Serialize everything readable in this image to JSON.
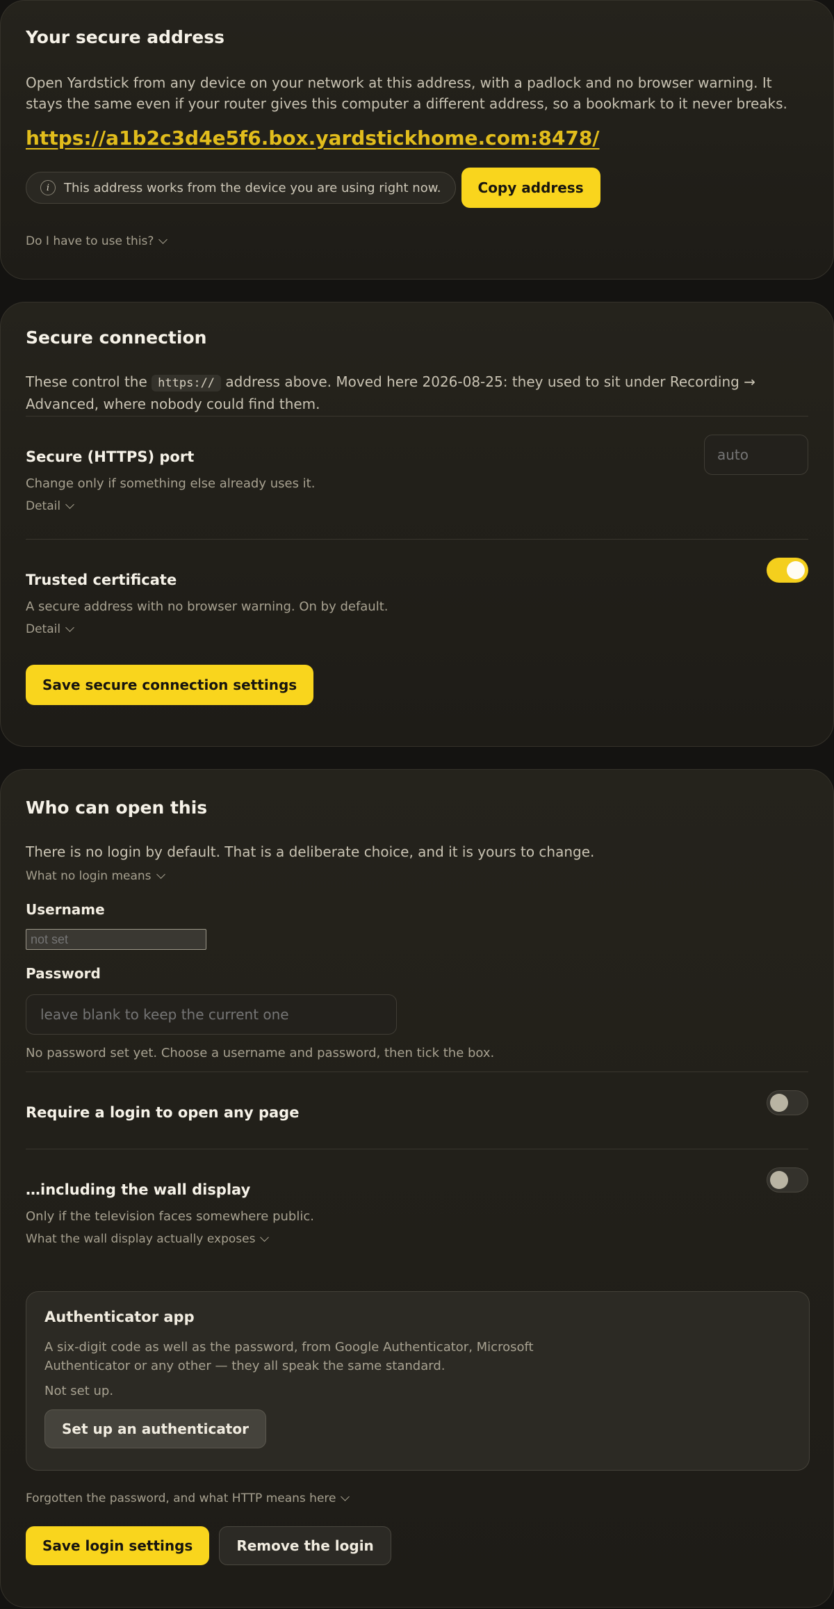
{
  "secure_address": {
    "title": "Your secure address",
    "description": "Open Yardstick from any device on your network at this address, with a padlock and no browser warning. It stays the same even if your router gives this computer a different address, so a bookmark to it never breaks.",
    "url": "https://a1b2c3d4e5f6.box.yardstickhome.com:8478/",
    "info_icon": "info-icon",
    "info_text": "This address works from the device you are using right now.",
    "copy_button": "Copy address",
    "disclosure": "Do I have to use this?"
  },
  "secure_connection": {
    "title": "Secure connection",
    "intro_before": "These control the",
    "intro_code": "https://",
    "intro_after": "address above. Moved here 2026-08-25: they used to sit under Recording → Advanced, where nobody could find them.",
    "https_port": {
      "label": "Secure (HTTPS) port",
      "description": "Change only if something else already uses it.",
      "detail": "Detail",
      "placeholder": "auto"
    },
    "trusted_certificate": {
      "label": "Trusted certificate",
      "description": "A secure address with no browser warning. On by default.",
      "detail": "Detail",
      "enabled": true
    },
    "save_button": "Save secure connection settings"
  },
  "who_can_open": {
    "title": "Who can open this",
    "intro": "There is no login by default. That is a deliberate choice, and it is yours to change.",
    "disclosure": "What no login means",
    "username": {
      "label": "Username",
      "placeholder": "not set"
    },
    "password": {
      "label": "Password",
      "placeholder": "leave blank to keep the current one",
      "hint": "No password set yet. Choose a username and password, then tick the box."
    },
    "require_login": {
      "label": "Require a login to open any page",
      "enabled": false
    },
    "wall_display": {
      "label": "…including the wall display",
      "description": "Only if the television faces somewhere public.",
      "disclosure": "What the wall display actually exposes",
      "enabled": false
    },
    "authenticator": {
      "title": "Authenticator app",
      "description": "A six-digit code as well as the password, from Google Authenticator, Microsoft Authenticator or any other — they all speak the same standard.",
      "status": "Not set up.",
      "button": "Set up an authenticator"
    },
    "forgot_disclosure": "Forgotten the password, and what HTTP means here",
    "save_button": "Save login settings",
    "remove_button": "Remove the login"
  },
  "colors": {
    "accent": "#f9d51d",
    "link": "#e2bd1c",
    "background": "#141311",
    "card": "#221f1a"
  }
}
